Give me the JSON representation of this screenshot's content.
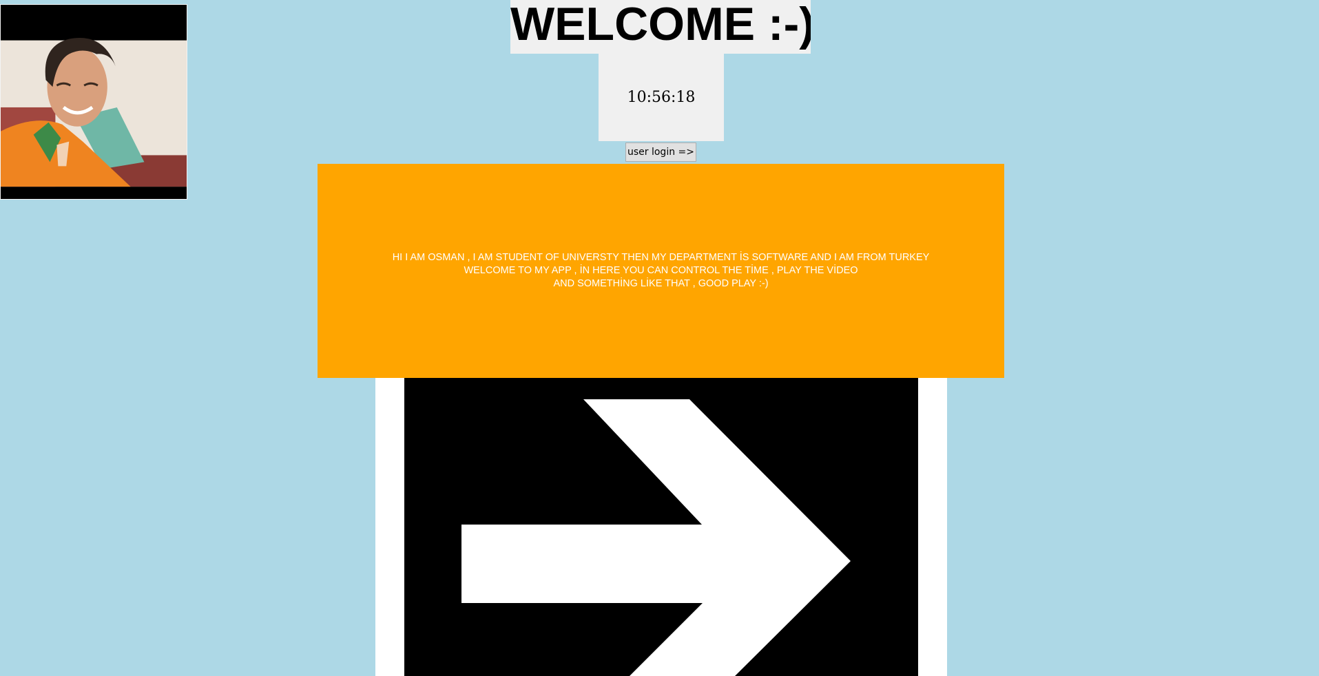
{
  "window": {
    "background_color": "#add8e6"
  },
  "profile": {
    "image": "portrait-photo"
  },
  "header": {
    "title": "WELCOME :-)",
    "panel_color": "#f0f0f0"
  },
  "clock": {
    "time": "10:56:18"
  },
  "login_button": {
    "label": "user login =>"
  },
  "intro": {
    "background_color": "#ffa500",
    "text_color": "#ffffff",
    "lines": [
      "HI I AM OSMAN , I AM STUDENT OF UNIVERSTY THEN MY DEPARTMENT İS SOFTWARE AND I AM FROM TURKEY",
      "WELCOME TO MY APP , İN HERE YOU CAN CONTROL THE TİME , PLAY THE VİDEO",
      "AND SOMETHİNG LİKE THAT , GOOD PLAY :-)"
    ]
  },
  "arrow_image": {
    "icon": "right-arrow-icon",
    "arrow_color": "#ffffff",
    "background_color": "#000000"
  }
}
